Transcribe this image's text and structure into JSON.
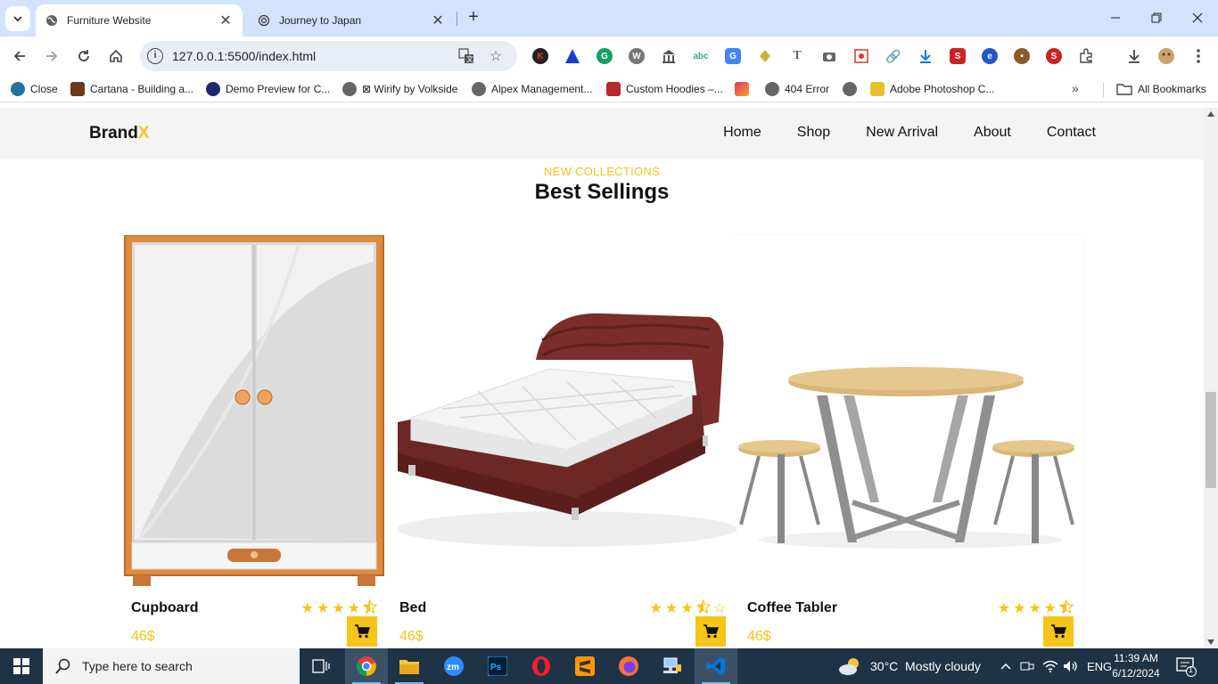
{
  "browser": {
    "tabs": [
      {
        "title": "Furniture Website",
        "active": true
      },
      {
        "title": "Journey to Japan",
        "active": false
      }
    ],
    "url": "127.0.0.1:5500/index.html",
    "bookmarks": [
      "Close",
      "Cartana - Building a...",
      "Demo Preview for C...",
      "⊠ Wirify by Volkside",
      "Alpex Management...",
      "Custom Hoodies –...",
      "404 Error",
      "Adobe Photoshop C..."
    ],
    "all_bookmarks": "All Bookmarks"
  },
  "site": {
    "brand_main": "Brand",
    "brand_accent": "X",
    "nav": [
      "Home",
      "Shop",
      "New Arrival",
      "About",
      "Contact"
    ],
    "kicker": "NEW COLLECTIONS",
    "heading": "Best Sellings",
    "rating_max": 5,
    "products": [
      {
        "name": "Cupboard",
        "price": "46$",
        "rating": 4.5
      },
      {
        "name": "Bed",
        "price": "46$",
        "rating": 3.5
      },
      {
        "name": "Coffee Tabler",
        "price": "46$",
        "rating": 4.5
      }
    ],
    "accent_color": "#f5c518"
  },
  "taskbar": {
    "search_placeholder": "Type here to search",
    "weather": "30°C  Mostly cloudy",
    "language": "ENG",
    "time": "11:39 AM",
    "date": "6/12/2024",
    "notification_count": "1"
  }
}
